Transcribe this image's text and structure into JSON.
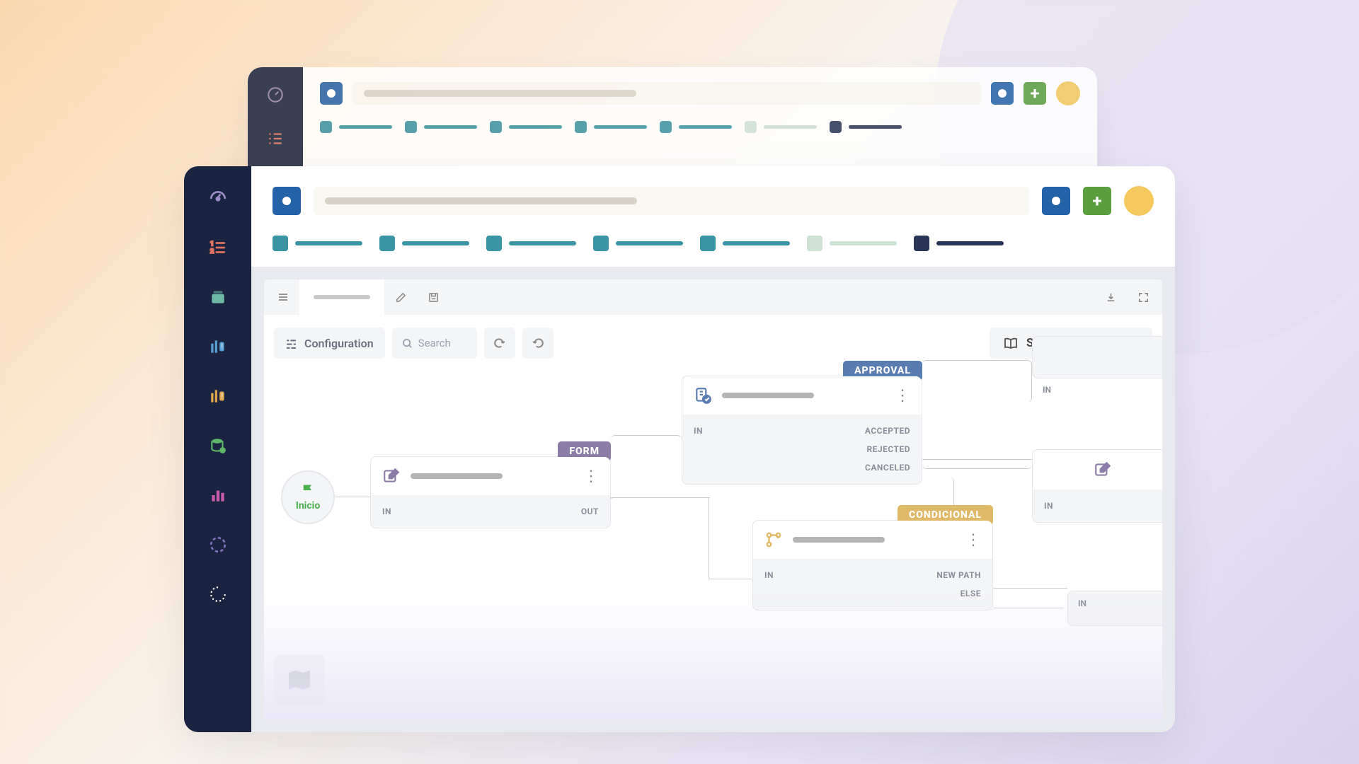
{
  "toolbar": {
    "configuration_label": "Configuration",
    "search_placeholder": "Search",
    "steps_menu_label": "Steps Menu"
  },
  "add_button_label": "+",
  "workflow": {
    "start_label": "Inicio",
    "form": {
      "tag": "FORM",
      "port_in": "IN",
      "port_out": "OUT"
    },
    "approval": {
      "tag": "APPROVAL",
      "port_in": "IN",
      "port_accepted": "ACCEPTED",
      "port_rejected": "REJECTED",
      "port_canceled": "CANCELED"
    },
    "conditional": {
      "tag": "CONDICIONAL",
      "port_in": "IN",
      "port_new_path": "NEW PATH",
      "port_else": "ELSE"
    },
    "stub1_port": "IN",
    "stub2_port": "IN",
    "stub3_port": "IN"
  }
}
